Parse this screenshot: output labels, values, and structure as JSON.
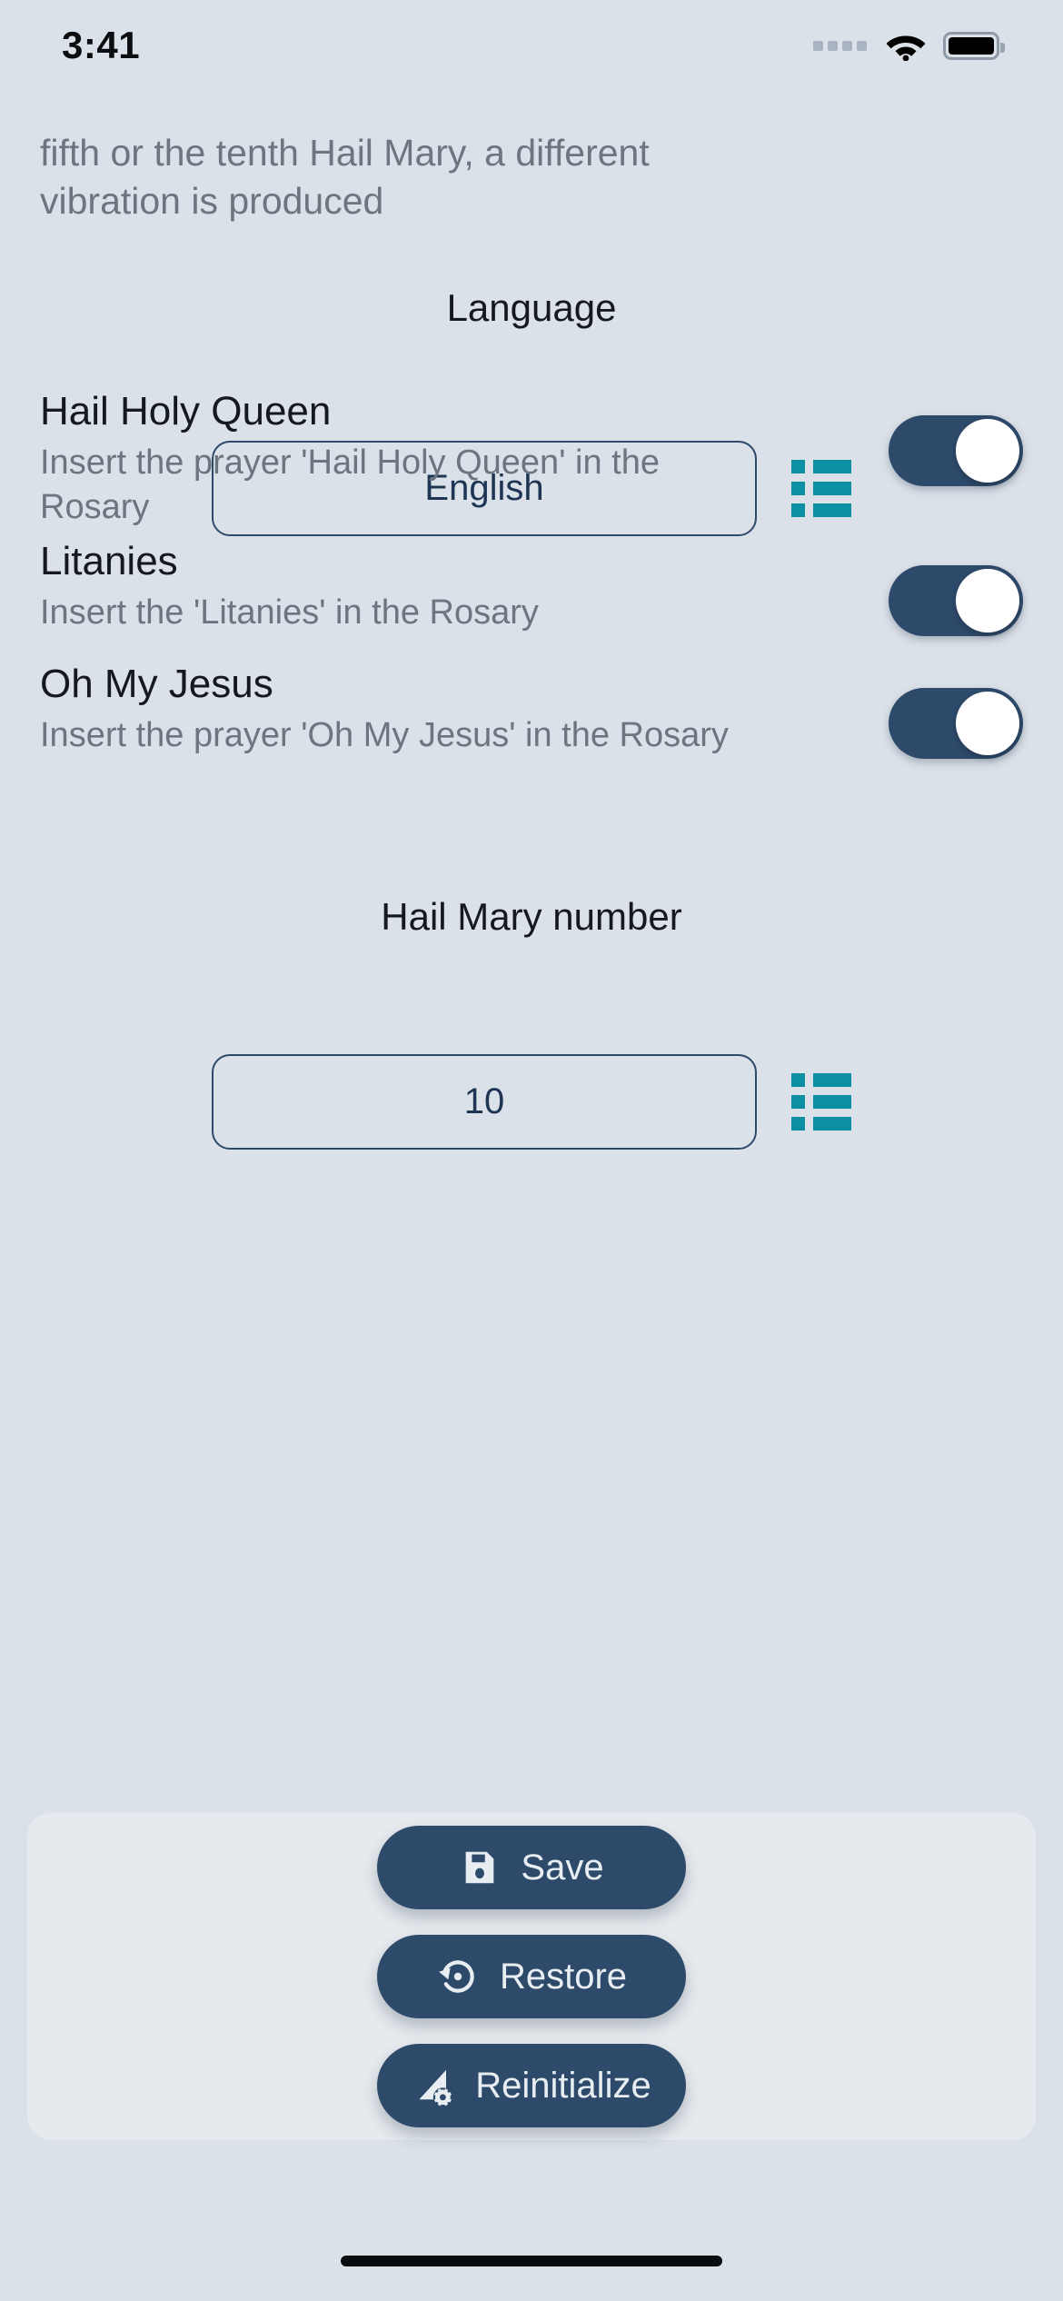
{
  "status_bar": {
    "time": "3:41",
    "signal_icon": "cellular-dots-icon",
    "wifi_icon": "wifi-icon",
    "battery_icon": "battery-full-icon"
  },
  "scrolled_text": {
    "clipped_paragraph": "fifth or the tenth Hail Mary, a different vibration is produced"
  },
  "language_section": {
    "label": "Language",
    "value": "English",
    "picker_icon": "list-icon"
  },
  "settings_toggles": [
    {
      "title": "Hail Holy Queen",
      "subtitle": "Insert the prayer 'Hail Holy Queen' in the Rosary",
      "state": "on"
    },
    {
      "title": "Litanies",
      "subtitle": "Insert the 'Litanies' in the Rosary",
      "state": "on"
    },
    {
      "title": "Oh My Jesus",
      "subtitle": "Insert the prayer 'Oh My Jesus' in the Rosary",
      "state": "on"
    }
  ],
  "hail_mary_section": {
    "label": "Hail Mary number",
    "value": "10",
    "picker_icon": "list-icon"
  },
  "actions": {
    "save": {
      "label": "Save",
      "icon": "floppy-disk-icon"
    },
    "restore": {
      "label": "Restore",
      "icon": "restore-rotate-icon"
    },
    "reinitialize": {
      "label": "Reinitialize",
      "icon": "reinitialize-gear-icon"
    }
  },
  "colors": {
    "background": "#dbe1e8",
    "panel": "#e6eaee",
    "primary_navy": "#2e4a6b",
    "accent_teal": "#0c8fa1",
    "text_primary": "#15181c",
    "text_secondary": "#6b7680",
    "field_text": "#1e3553"
  }
}
